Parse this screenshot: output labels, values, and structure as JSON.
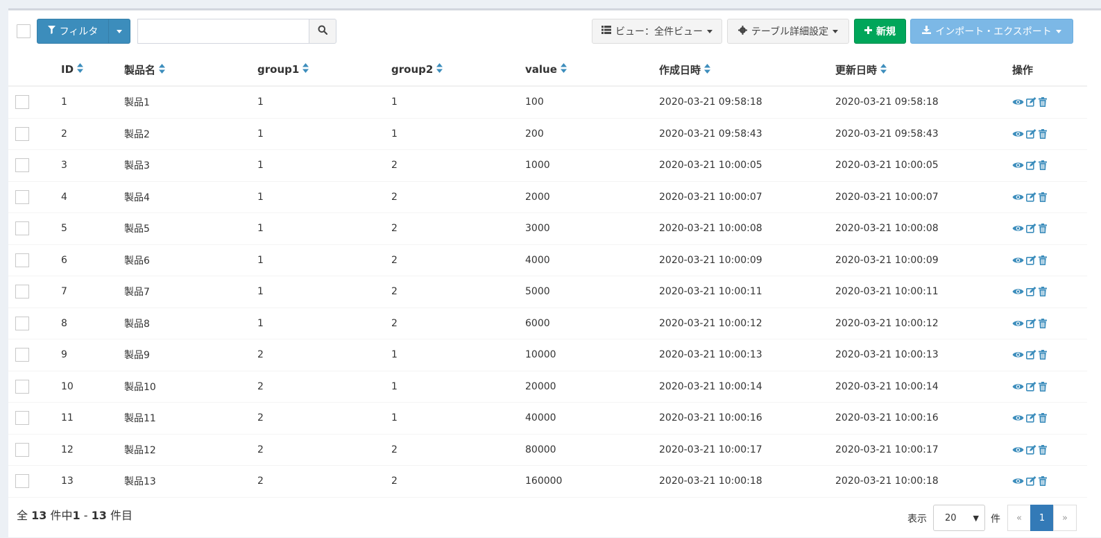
{
  "toolbar": {
    "filter_label": "フィルタ",
    "search_placeholder": "",
    "view_label": "ビュー：全件ビュー",
    "table_settings_label": "テーブル詳細設定",
    "new_label": "新規",
    "import_export_label": "インポート・エクスポート"
  },
  "table": {
    "headers": [
      "ID",
      "製品名",
      "group1",
      "group2",
      "value",
      "作成日時",
      "更新日時",
      "操作"
    ],
    "rows": [
      {
        "id": "1",
        "name": "製品1",
        "group1": "1",
        "group2": "1",
        "value": "100",
        "created": "2020-03-21 09:58:18",
        "updated": "2020-03-21 09:58:18"
      },
      {
        "id": "2",
        "name": "製品2",
        "group1": "1",
        "group2": "1",
        "value": "200",
        "created": "2020-03-21 09:58:43",
        "updated": "2020-03-21 09:58:43"
      },
      {
        "id": "3",
        "name": "製品3",
        "group1": "1",
        "group2": "2",
        "value": "1000",
        "created": "2020-03-21 10:00:05",
        "updated": "2020-03-21 10:00:05"
      },
      {
        "id": "4",
        "name": "製品4",
        "group1": "1",
        "group2": "2",
        "value": "2000",
        "created": "2020-03-21 10:00:07",
        "updated": "2020-03-21 10:00:07"
      },
      {
        "id": "5",
        "name": "製品5",
        "group1": "1",
        "group2": "2",
        "value": "3000",
        "created": "2020-03-21 10:00:08",
        "updated": "2020-03-21 10:00:08"
      },
      {
        "id": "6",
        "name": "製品6",
        "group1": "1",
        "group2": "2",
        "value": "4000",
        "created": "2020-03-21 10:00:09",
        "updated": "2020-03-21 10:00:09"
      },
      {
        "id": "7",
        "name": "製品7",
        "group1": "1",
        "group2": "2",
        "value": "5000",
        "created": "2020-03-21 10:00:11",
        "updated": "2020-03-21 10:00:11"
      },
      {
        "id": "8",
        "name": "製品8",
        "group1": "1",
        "group2": "2",
        "value": "6000",
        "created": "2020-03-21 10:00:12",
        "updated": "2020-03-21 10:00:12"
      },
      {
        "id": "9",
        "name": "製品9",
        "group1": "2",
        "group2": "1",
        "value": "10000",
        "created": "2020-03-21 10:00:13",
        "updated": "2020-03-21 10:00:13"
      },
      {
        "id": "10",
        "name": "製品10",
        "group1": "2",
        "group2": "1",
        "value": "20000",
        "created": "2020-03-21 10:00:14",
        "updated": "2020-03-21 10:00:14"
      },
      {
        "id": "11",
        "name": "製品11",
        "group1": "2",
        "group2": "1",
        "value": "40000",
        "created": "2020-03-21 10:00:16",
        "updated": "2020-03-21 10:00:16"
      },
      {
        "id": "12",
        "name": "製品12",
        "group1": "2",
        "group2": "2",
        "value": "80000",
        "created": "2020-03-21 10:00:17",
        "updated": "2020-03-21 10:00:17"
      },
      {
        "id": "13",
        "name": "製品13",
        "group1": "2",
        "group2": "2",
        "value": "160000",
        "created": "2020-03-21 10:00:18",
        "updated": "2020-03-21 10:00:18"
      }
    ]
  },
  "footer": {
    "summary_prefix": "全",
    "total": "13",
    "summary_mid": "件中",
    "range_start": "1",
    "range_sep": "-",
    "range_end": "13",
    "summary_suffix": "件目",
    "per_page_label": "表示",
    "per_page_value": "20",
    "per_page_unit": "件",
    "pager": {
      "prev": "«",
      "current": "1",
      "next": "»"
    }
  },
  "colors": {
    "primary": "#3c8dbc",
    "success": "#00a65a",
    "action_icon": "#3c8dbc"
  },
  "icons": {
    "filter": "filter-icon",
    "search": "search-icon",
    "view": "list-icon",
    "settings": "gear-icon",
    "new": "plus-icon",
    "import_export": "download-icon",
    "row_actions": [
      "eye-icon",
      "edit-icon",
      "trash-icon"
    ]
  }
}
